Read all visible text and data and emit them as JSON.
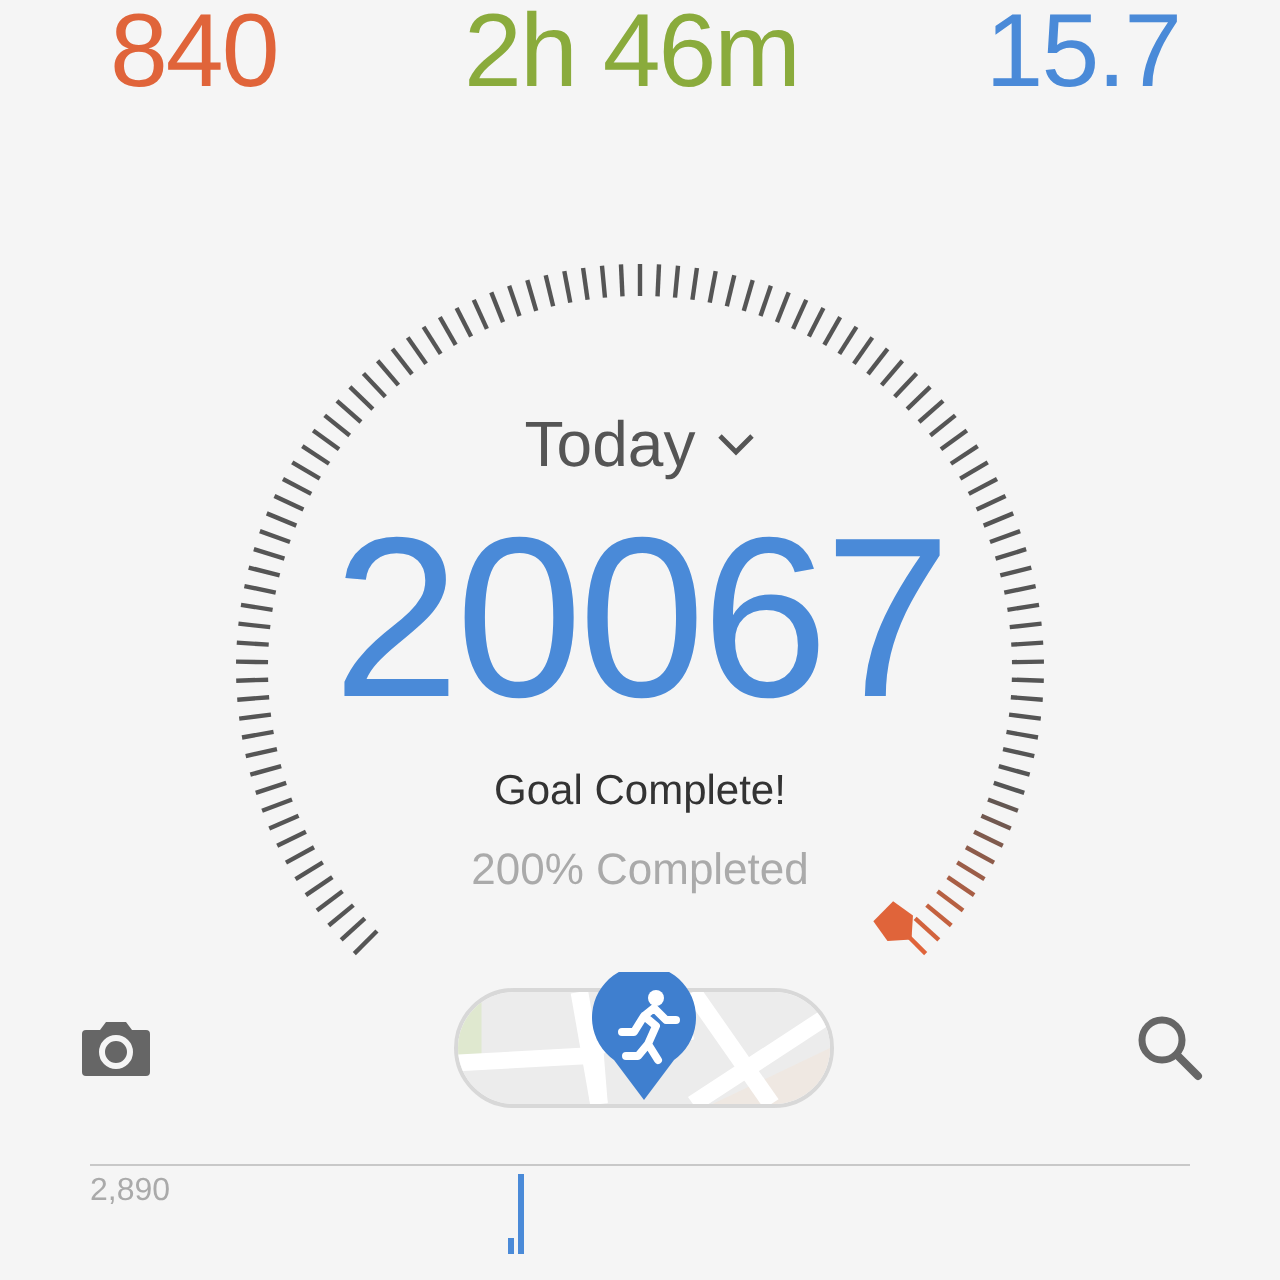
{
  "stats": [
    {
      "value": "840",
      "color": "#e0643a"
    },
    {
      "value": "2h 46m",
      "color": "#8aab3c"
    },
    {
      "value": "15.7",
      "color": "#4a8ad8"
    }
  ],
  "period": {
    "label": "Today"
  },
  "steps": "20067",
  "goal_status": "Goal Complete!",
  "completion": "200% Completed",
  "chart": {
    "axis_label": "2,890"
  }
}
